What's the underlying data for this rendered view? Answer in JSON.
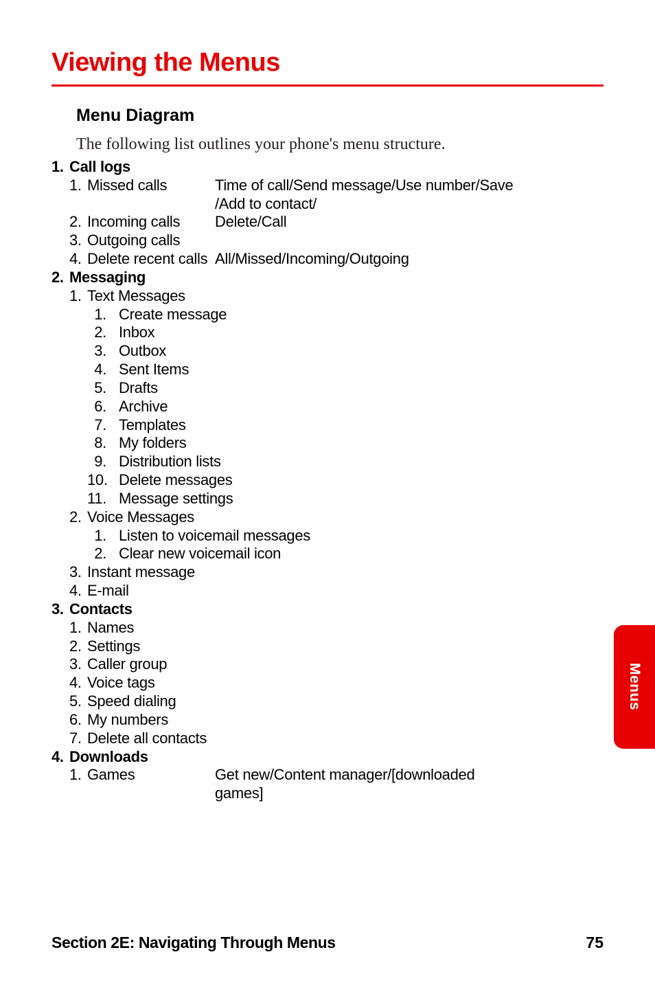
{
  "heading": "Viewing the Menus",
  "section_heading": "Menu Diagram",
  "intro": "The following list outlines your phone's menu structure.",
  "menu": {
    "m1": {
      "num": "1.",
      "title": "Call logs",
      "items": {
        "i1": {
          "num": "1.",
          "label": "Missed calls",
          "right1": "Time of call/Send message/Use number/Save",
          "right2": "/Add to contact/"
        },
        "i2": {
          "num": "2.",
          "label": "Incoming calls",
          "right": "Delete/Call"
        },
        "i3": {
          "num": "3.",
          "label": "Outgoing calls"
        },
        "i4": {
          "num": "4.",
          "label": "Delete recent calls",
          "right": "All/Missed/Incoming/Outgoing"
        }
      }
    },
    "m2": {
      "num": "2.",
      "title": "Messaging",
      "items": {
        "i1": {
          "num": "1.",
          "label": "Text Messages",
          "sub": {
            "s1": {
              "num": "1.",
              "label": "Create message"
            },
            "s2": {
              "num": "2.",
              "label": "Inbox"
            },
            "s3": {
              "num": "3.",
              "label": "Outbox"
            },
            "s4": {
              "num": "4.",
              "label": "Sent Items"
            },
            "s5": {
              "num": "5.",
              "label": "Drafts"
            },
            "s6": {
              "num": "6.",
              "label": "Archive"
            },
            "s7": {
              "num": "7.",
              "label": "Templates"
            },
            "s8": {
              "num": "8.",
              "label": "My folders"
            },
            "s9": {
              "num": "9.",
              "label": "Distribution lists"
            },
            "s10": {
              "num": "10.",
              "label": "Delete messages"
            },
            "s11": {
              "num": "11.",
              "label": "Message settings"
            }
          }
        },
        "i2": {
          "num": "2.",
          "label": "Voice Messages",
          "sub": {
            "s1": {
              "num": "1.",
              "label": "Listen to voicemail messages"
            },
            "s2": {
              "num": "2.",
              "label": "Clear new voicemail icon"
            }
          }
        },
        "i3": {
          "num": "3.",
          "label": "Instant message"
        },
        "i4": {
          "num": "4.",
          "label": "E-mail"
        }
      }
    },
    "m3": {
      "num": "3.",
      "title": "Contacts",
      "items": {
        "i1": {
          "num": "1.",
          "label": "Names"
        },
        "i2": {
          "num": "2.",
          "label": "Settings"
        },
        "i3": {
          "num": "3.",
          "label": "Caller group"
        },
        "i4": {
          "num": "4.",
          "label": "Voice tags"
        },
        "i5": {
          "num": "5.",
          "label": "Speed dialing"
        },
        "i6": {
          "num": "6.",
          "label": "My numbers"
        },
        "i7": {
          "num": "7.",
          "label": "Delete all contacts"
        }
      }
    },
    "m4": {
      "num": "4.",
      "title": "Downloads",
      "items": {
        "i1": {
          "num": "1.",
          "label": "Games",
          "right1": "Get new/Content manager/[downloaded",
          "right2": "games]"
        }
      }
    }
  },
  "side_tab": "Menus",
  "footer_left": "Section 2E: Navigating Through Menus",
  "footer_right": "75"
}
